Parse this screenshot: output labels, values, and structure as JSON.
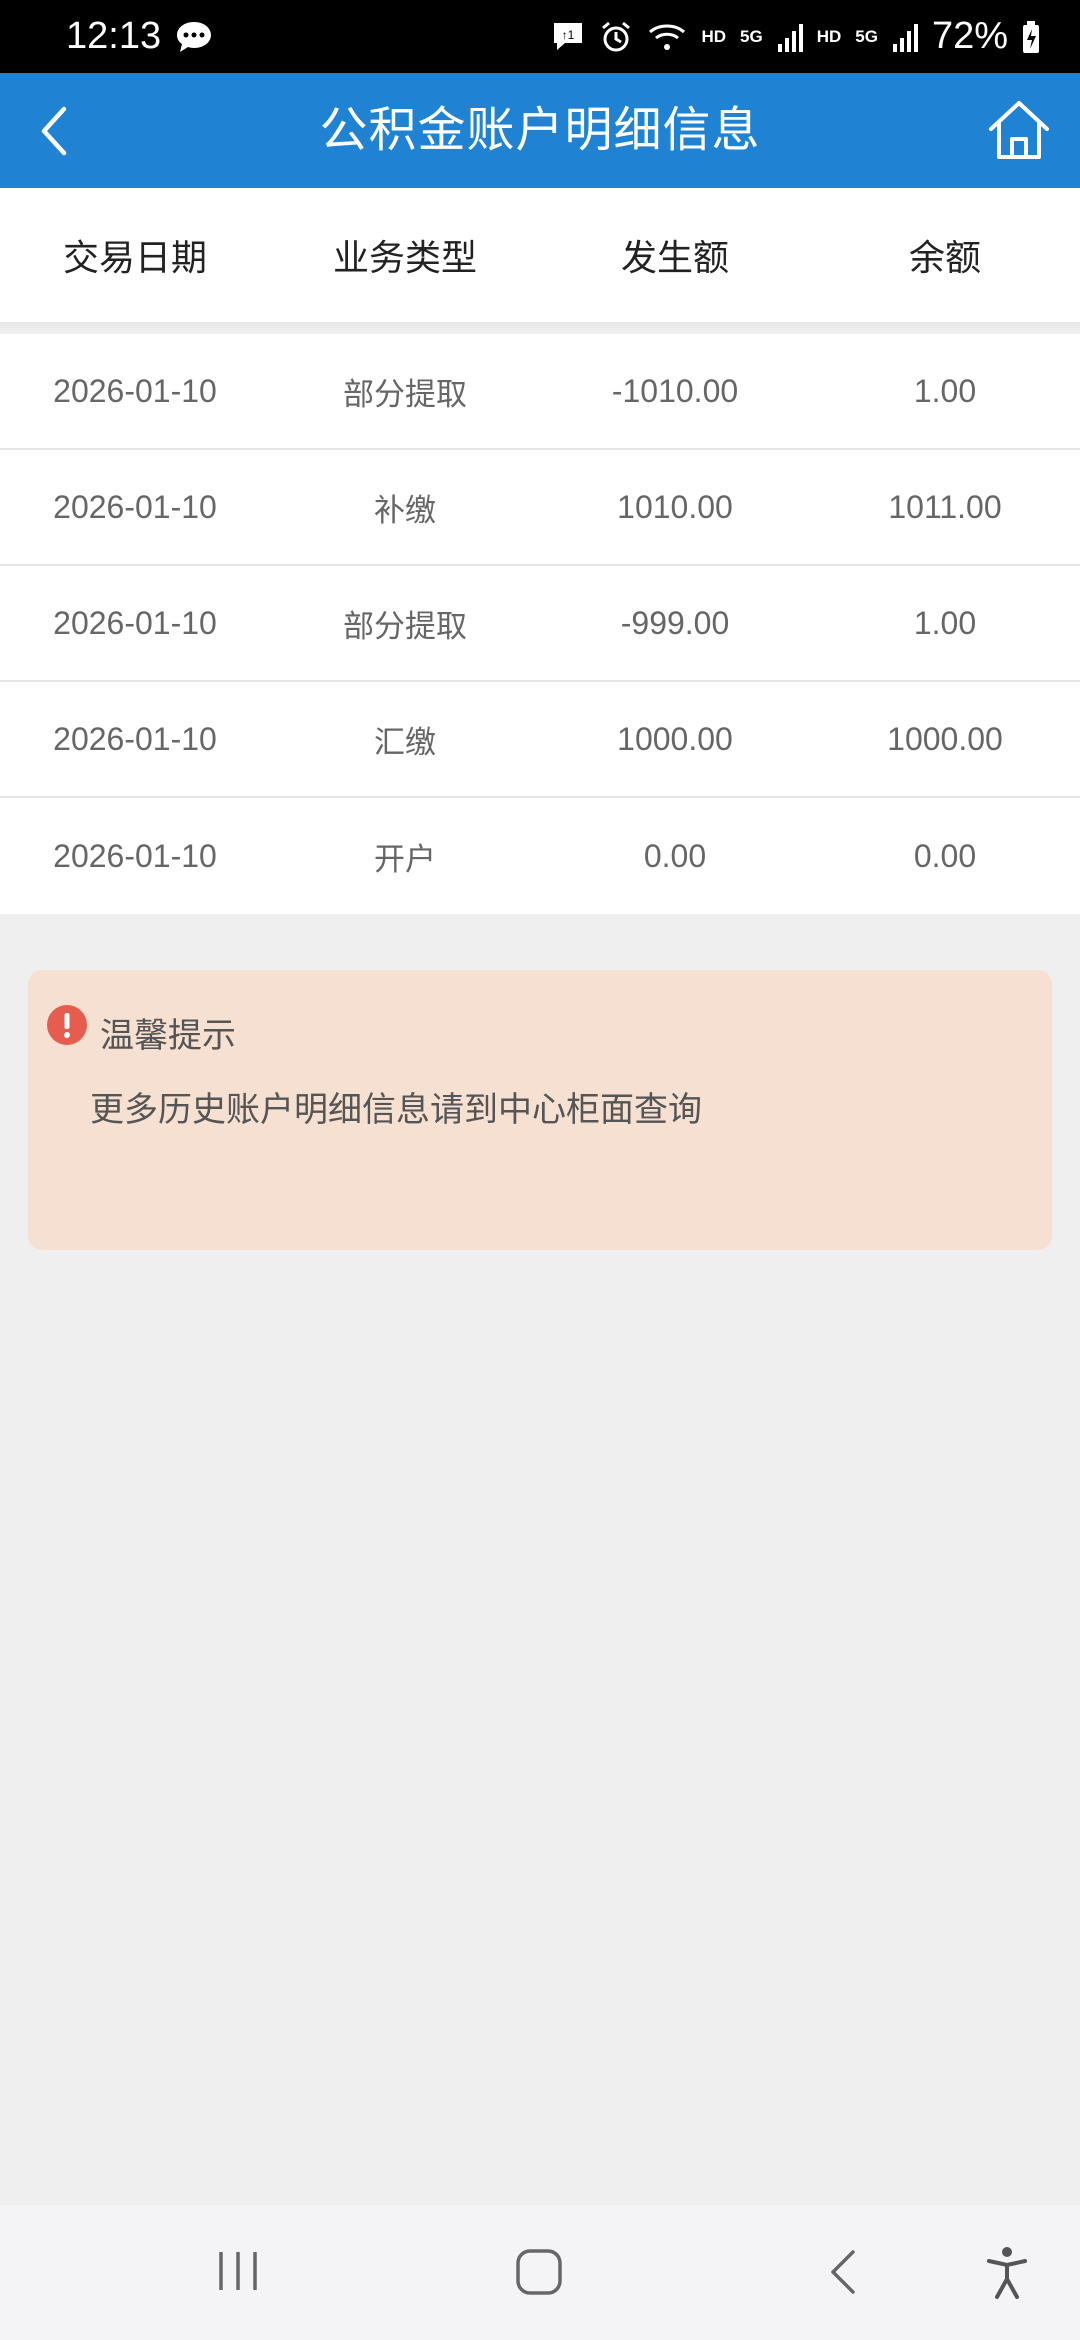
{
  "status_bar": {
    "time": "12:13",
    "network_hd_1": "HD",
    "network_5g_1": "5G",
    "network_hd_2": "HD",
    "network_5g_2": "5G",
    "battery": "72%"
  },
  "header": {
    "title": "公积金账户明细信息"
  },
  "table": {
    "columns": [
      "交易日期",
      "业务类型",
      "发生额",
      "余额"
    ],
    "rows": [
      {
        "date": "2026-01-10",
        "type": "部分提取",
        "amount": "-1010.00",
        "balance": "1.00"
      },
      {
        "date": "2026-01-10",
        "type": "补缴",
        "amount": "1010.00",
        "balance": "1011.00"
      },
      {
        "date": "2026-01-10",
        "type": "部分提取",
        "amount": "-999.00",
        "balance": "1.00"
      },
      {
        "date": "2026-01-10",
        "type": "汇缴",
        "amount": "1000.00",
        "balance": "1000.00"
      },
      {
        "date": "2026-01-10",
        "type": "开户",
        "amount": "0.00",
        "balance": "0.00"
      }
    ]
  },
  "notice": {
    "title": "温馨提示",
    "body": "更多历史账户明细信息请到中心柜面查询"
  },
  "colors": {
    "header_bg": "#1f82d2",
    "notice_bg": "#f6e0d2",
    "alert_icon": "#e65c4f"
  }
}
